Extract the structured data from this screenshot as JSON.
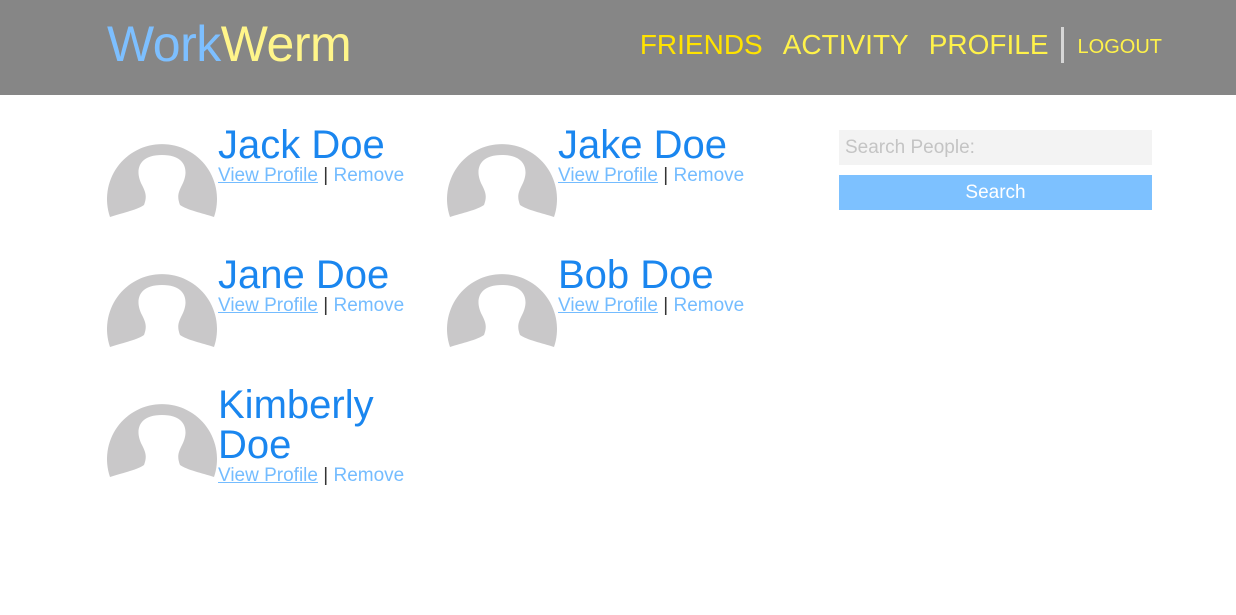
{
  "header": {
    "logo_part1": "Work",
    "logo_part2": "Werm",
    "nav": {
      "friends": "FRIENDS",
      "activity": "ACTIVITY",
      "profile": "PROFILE",
      "logout": "LOGOUT"
    }
  },
  "friends": [
    {
      "name": "Jack Doe",
      "view_label": "View Profile",
      "separator": "|",
      "remove_label": "Remove"
    },
    {
      "name": "Jake Doe",
      "view_label": "View Profile",
      "separator": "|",
      "remove_label": "Remove"
    },
    {
      "name": "Jane Doe",
      "view_label": "View Profile",
      "separator": "|",
      "remove_label": "Remove"
    },
    {
      "name": "Bob Doe",
      "view_label": "View Profile",
      "separator": "|",
      "remove_label": "Remove"
    },
    {
      "name": "Kimberly Doe",
      "view_label": "View Profile",
      "separator": "|",
      "remove_label": "Remove"
    }
  ],
  "search": {
    "placeholder": "Search People:",
    "value": "",
    "button_label": "Search"
  },
  "colors": {
    "header_bg": "#868686",
    "logo_blue": "#7dbfff",
    "logo_yellow": "#fff58a",
    "nav_yellow": "#fff24a",
    "name_blue": "#1a86ef",
    "link_blue": "#74bcff",
    "avatar_gray": "#c9c8c9",
    "button_blue": "#7dc1ff"
  },
  "icons": {
    "avatar": "default-user-avatar-icon"
  }
}
